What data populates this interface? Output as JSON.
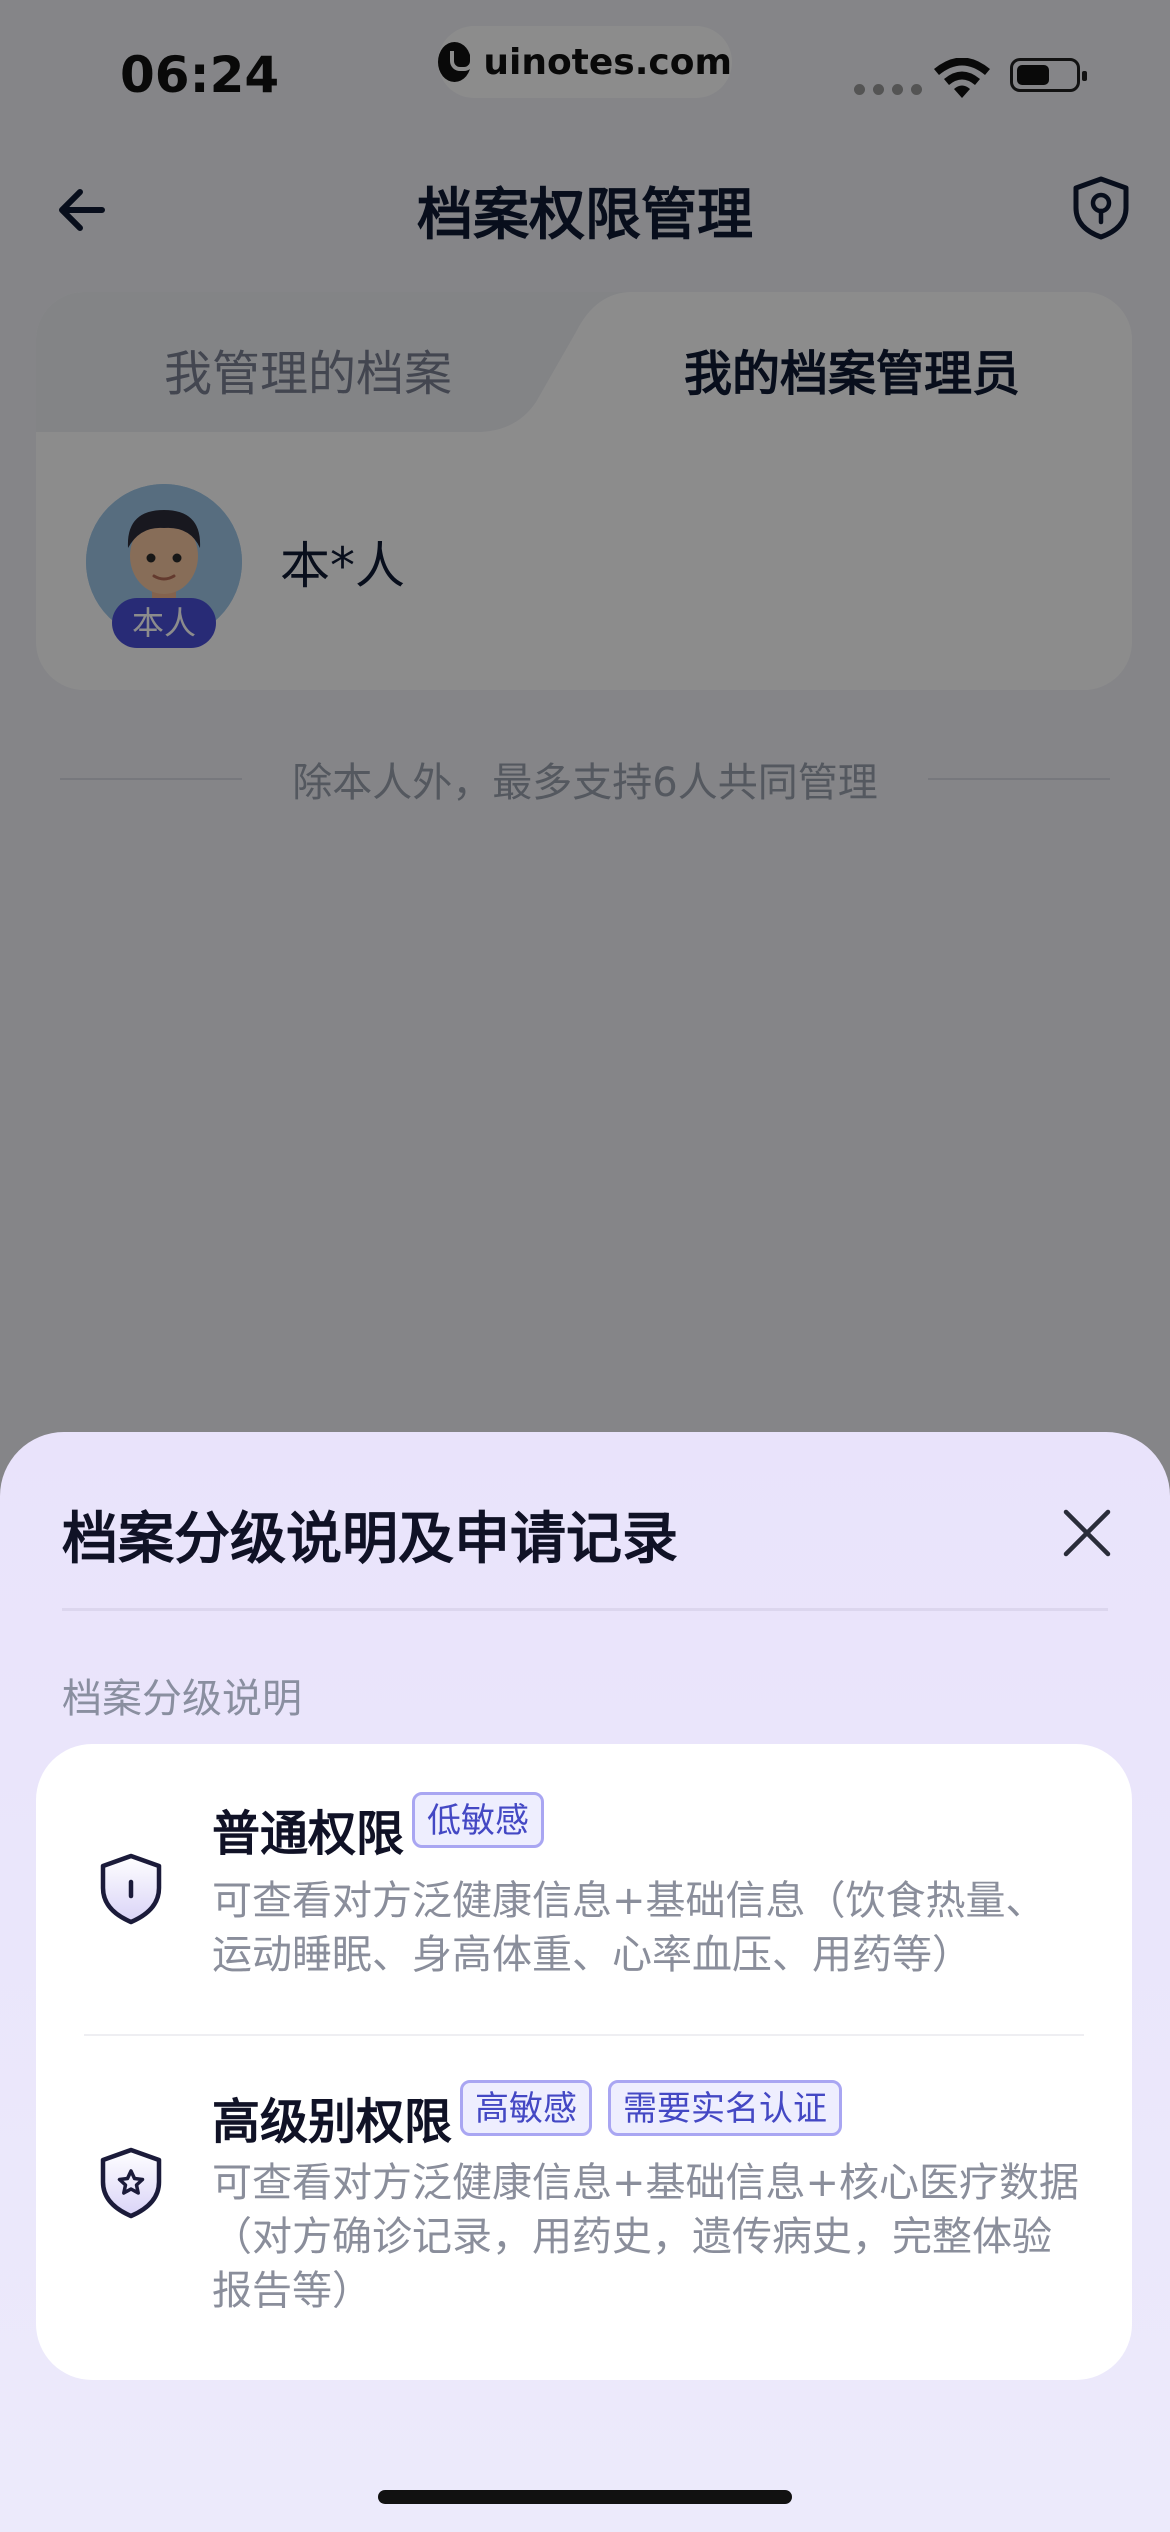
{
  "status_bar": {
    "time": "06:24",
    "site": "uinotes.com"
  },
  "header": {
    "title": "档案权限管理"
  },
  "tabs": [
    {
      "label": "我管理的档案",
      "selected": false
    },
    {
      "label": "我的档案管理员",
      "selected": true
    }
  ],
  "member": {
    "name": "本*人",
    "badge": "本人"
  },
  "note": "除本人外，最多支持6人共同管理",
  "sheet": {
    "title": "档案分级说明及申请记录",
    "section_label": "档案分级说明",
    "levels": [
      {
        "name": "普通权限",
        "tags": [
          "低敏感"
        ],
        "desc_line1": "可查看对方泛健康信息+基础信息（饮食热量、",
        "desc_line2": "运动睡眠、身高体重、心率血压、用药等）"
      },
      {
        "name": "高级别权限",
        "tags": [
          "高敏感",
          "需要实名认证"
        ],
        "desc_line1": "可查看对方泛健康信息+基础信息+核心医疗数据",
        "desc_line2": "（对方确诊记录，用药史，遗传病史，完整体验",
        "desc_line3": "报告等）"
      }
    ]
  },
  "colors": {
    "accent": "#4a4fd8",
    "tag_border": "#a9a6f2",
    "title": "#0f1b33"
  }
}
